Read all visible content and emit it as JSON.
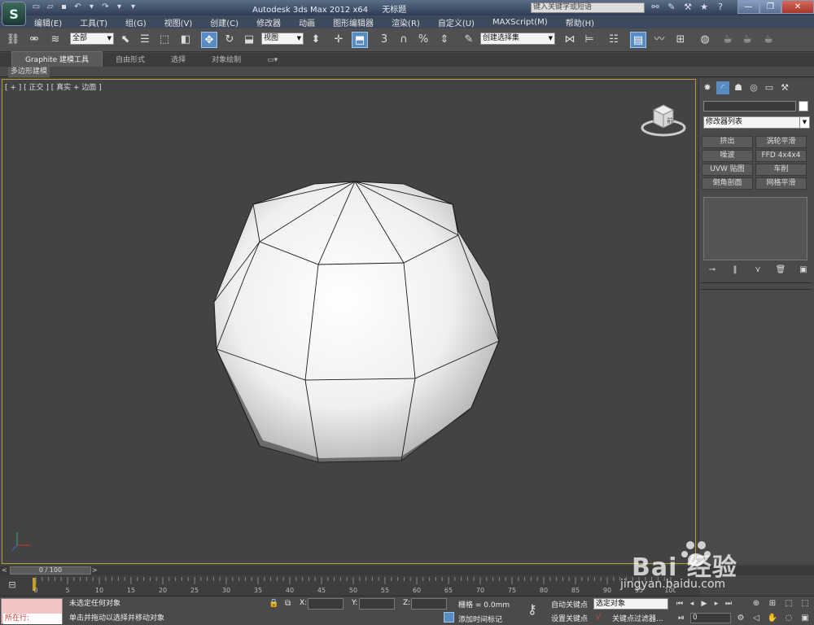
{
  "titlebar": {
    "app_name": "Autodesk 3ds Max  2012 x64",
    "document": "无标题",
    "search_placeholder": "键入关键字或短语",
    "logo_glyph": "S",
    "window_buttons": [
      "—",
      "❐",
      "✕"
    ]
  },
  "menubar": {
    "items": [
      "编辑(E)",
      "工具(T)",
      "组(G)",
      "视图(V)",
      "创建(C)",
      "修改器",
      "动画",
      "图形编辑器",
      "渲染(R)",
      "自定义(U)",
      "MAXScript(M)",
      "帮助(H)"
    ]
  },
  "toolbar": {
    "filter_value": "全部",
    "refcoord_value": "视图",
    "selset_value": "创建选择集",
    "snap_label": "3",
    "percent_label": "%"
  },
  "ribbon": {
    "tabs": [
      "Graphite 建模工具",
      "自由形式",
      "选择",
      "对象绘制"
    ],
    "subtab": "多边形建模"
  },
  "viewport": {
    "label": "[ + ] [ 正交 ] [ 真实 + 边面 ]",
    "viewcube_face": "前",
    "background": "#434343",
    "border": "#b99b3a"
  },
  "command_panel": {
    "modifier_list": "修改器列表",
    "modifier_buttons": [
      "挤出",
      "涡轮平滑",
      "噪波",
      "FFD 4x4x4",
      "UVW 贴图",
      "车削",
      "倒角剖面",
      "网格平滑"
    ]
  },
  "timeline": {
    "slider_value": "0 / 100",
    "ticks": [
      0,
      5,
      10,
      15,
      20,
      25,
      30,
      35,
      40,
      45,
      50,
      55,
      60,
      65,
      70,
      75,
      80,
      85,
      90,
      95,
      100
    ]
  },
  "statusbar": {
    "running": "所在行:",
    "status_line1": "未选定任何对象",
    "status_line2": "单击并拖动以选择并移动对象",
    "x_label": "X:",
    "y_label": "Y:",
    "z_label": "Z:",
    "grid": "栅格 = 0.0mm",
    "add_time_tag": "添加时间标记",
    "auto_key": "自动关键点",
    "set_key": "设置关键点",
    "selected_dropdown": "选定对象",
    "key_filters": "关键点过滤器...",
    "frame_value": "0"
  },
  "watermark": {
    "brand": "Bai 经验",
    "url": "jingyan.baidu.com"
  }
}
